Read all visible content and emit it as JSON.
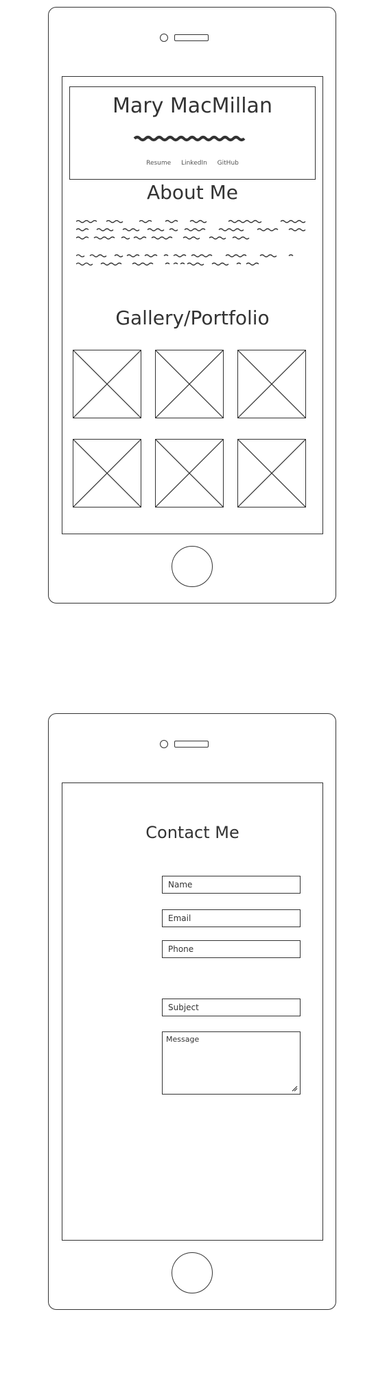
{
  "mockup1": {
    "header": {
      "name": "Mary MacMillan",
      "nav": [
        "Resume",
        "LinkedIn",
        "GitHub"
      ]
    },
    "about": {
      "title": "About Me"
    },
    "gallery": {
      "title": "Gallery/Portfolio",
      "item_count": 6
    }
  },
  "mockup2": {
    "contact": {
      "title": "Contact Me",
      "fields": {
        "name": "Name",
        "email": "Email",
        "phone": "Phone",
        "subject": "Subject",
        "message": "Message"
      }
    }
  },
  "icons": [
    "speaker-icon",
    "home-button-icon",
    "image-placeholder-icon",
    "resize-handle-icon"
  ]
}
